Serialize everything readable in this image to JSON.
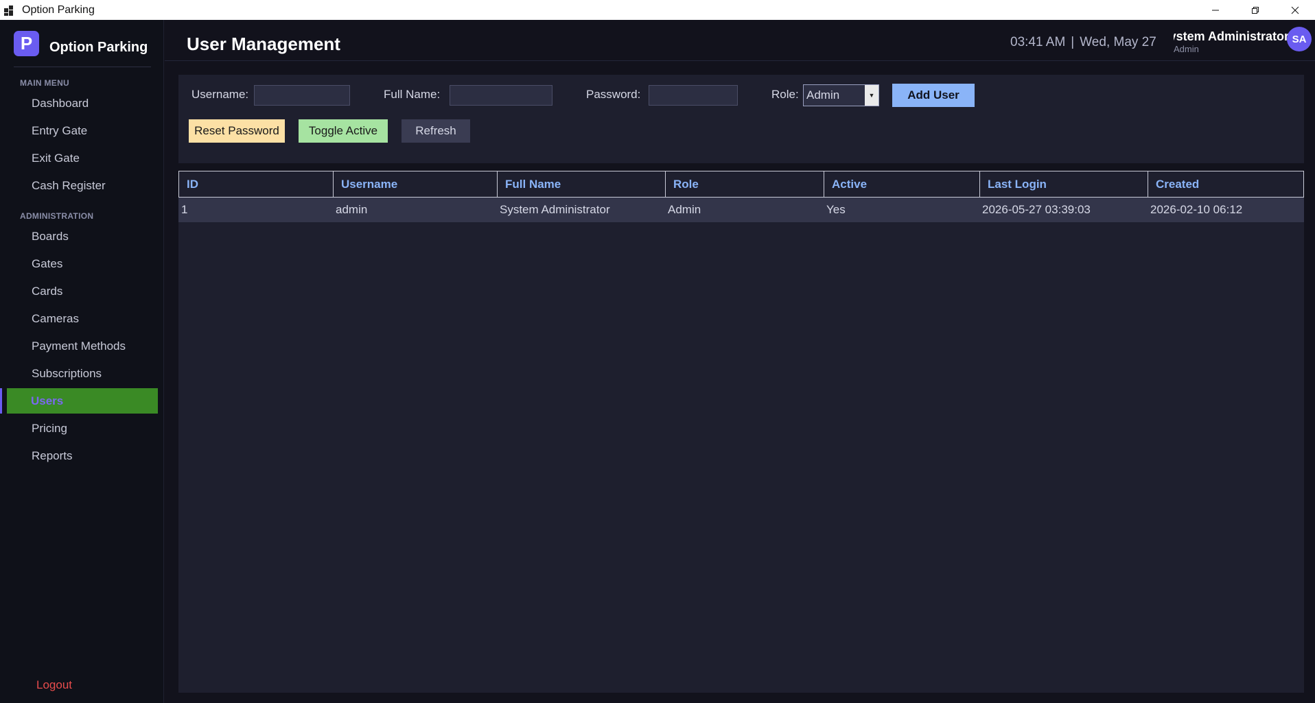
{
  "window": {
    "title": "Option Parking",
    "icon": "app-windows-icon",
    "controls": [
      "minimize-icon",
      "restore-icon",
      "close-icon"
    ]
  },
  "sidebar": {
    "brand_letter": "P",
    "brand_name": "Option Parking",
    "sections": [
      {
        "label": "MAIN MENU",
        "items": [
          {
            "label": "Dashboard"
          },
          {
            "label": "Entry Gate"
          },
          {
            "label": "Exit Gate"
          },
          {
            "label": "Cash Register"
          }
        ]
      },
      {
        "label": "ADMINISTRATION",
        "items": [
          {
            "label": "Boards"
          },
          {
            "label": "Gates"
          },
          {
            "label": "Cards"
          },
          {
            "label": "Cameras"
          },
          {
            "label": "Payment Methods"
          },
          {
            "label": "Subscriptions"
          },
          {
            "label": "Users",
            "active": true
          },
          {
            "label": "Pricing"
          },
          {
            "label": "Reports"
          }
        ]
      }
    ],
    "logout_label": "Logout",
    "colors": {
      "active_bg": "#3a8a25",
      "active_text": "#7a68f0",
      "logout": "#e74c4c",
      "brand": "#6a5cf0"
    }
  },
  "header": {
    "title": "User Management",
    "time": "03:41 AM",
    "separator": "|",
    "date": "Wed, May 27",
    "user_name": "System Administrator",
    "user_role": "Admin",
    "avatar_initials": "SA"
  },
  "form": {
    "username_label": "Username:",
    "username_value": "",
    "fullname_label": "Full Name:",
    "fullname_value": "",
    "password_label": "Password:",
    "password_value": "",
    "role_label": "Role:",
    "role_value": "Admin",
    "add_label": "Add User",
    "reset_label": "Reset Password",
    "toggle_label": "Toggle Active",
    "refresh_label": "Refresh"
  },
  "table": {
    "columns": [
      "ID",
      "Username",
      "Full Name",
      "Role",
      "Active",
      "Last Login",
      "Created"
    ],
    "rows": [
      [
        "1",
        "admin",
        "System Administrator",
        "Admin",
        "Yes",
        "2026-05-27 03:39:03",
        "2026-02-10 06:12"
      ]
    ]
  }
}
